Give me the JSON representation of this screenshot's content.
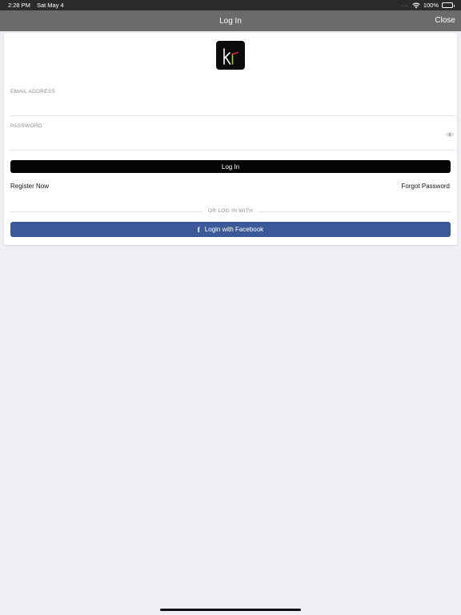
{
  "status_bar": {
    "time": "2:28 PM",
    "date": "Sat May 4",
    "signal": "....",
    "battery": "100%"
  },
  "nav": {
    "title": "Log In",
    "close_label": "Close"
  },
  "logo": {
    "icon": "kr-logo",
    "colors": {
      "k": "#ffffff",
      "r": "#9ecb3c",
      "accent": "#d0182c"
    }
  },
  "form": {
    "email": {
      "label": "EMAIL ADDRESS",
      "value": "",
      "placeholder": ""
    },
    "password": {
      "label": "PASSWORD",
      "value": "",
      "placeholder": "",
      "icon": "eye-icon"
    },
    "login_label": "Log In",
    "register_label": "Register Now",
    "forgot_label": "Forgot Password",
    "divider_label": "OR LOG IN WITH",
    "facebook_label": "Login with Facebook",
    "facebook_icon": "facebook-f-icon"
  },
  "colors": {
    "nav_bar": "#6b6b6b",
    "login_button": "#050505",
    "facebook": "#3b5998",
    "background": "#efeff4"
  }
}
